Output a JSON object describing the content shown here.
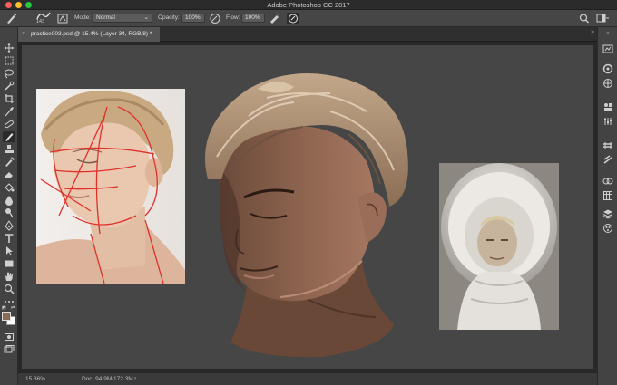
{
  "window": {
    "title": "Adobe Photoshop CC 2017",
    "traffic_lights": [
      "#ff5f57",
      "#febc2e",
      "#28c840"
    ]
  },
  "options_bar": {
    "brush_size": "143",
    "mode_label": "Mode:",
    "mode_value": "Normal",
    "opacity_label": "Opacity:",
    "opacity_value": "100%",
    "flow_label": "Flow:",
    "flow_value": "100%"
  },
  "document": {
    "tab_label": "practice003.psd @ 15.4% (Layer 34, RGB/8) *",
    "close_glyph": "×",
    "collapse_glyph": "»"
  },
  "status": {
    "zoom": "15.36%",
    "doc_size": "Doc: 94.9M/172.3M",
    "arrow": "›"
  },
  "colors": {
    "foreground": "#8b6a56",
    "background": "#ffffff",
    "accent_red": "#e0302a"
  },
  "toolbar": {
    "tools": [
      "move-icon",
      "marquee-icon",
      "lasso-icon",
      "quick-select-icon",
      "crop-icon",
      "eyedropper-icon",
      "healing-icon",
      "brush-icon",
      "stamp-icon",
      "history-brush-icon",
      "eraser-icon",
      "gradient-icon",
      "blur-icon",
      "dodge-icon",
      "pen-icon",
      "type-icon",
      "path-select-icon",
      "rectangle-icon",
      "hand-icon",
      "zoom-icon",
      "more-icon"
    ]
  },
  "right_panel": {
    "icons": [
      "history-icon",
      "color-icon",
      "swatches-icon",
      "adjustments-icon",
      "properties-icon",
      "libraries-icon",
      "brushes-icon",
      "channels-icon",
      "paths-icon",
      "layers-icon",
      "grid-icon",
      "layers-stack-icon",
      "styles-icon"
    ]
  }
}
